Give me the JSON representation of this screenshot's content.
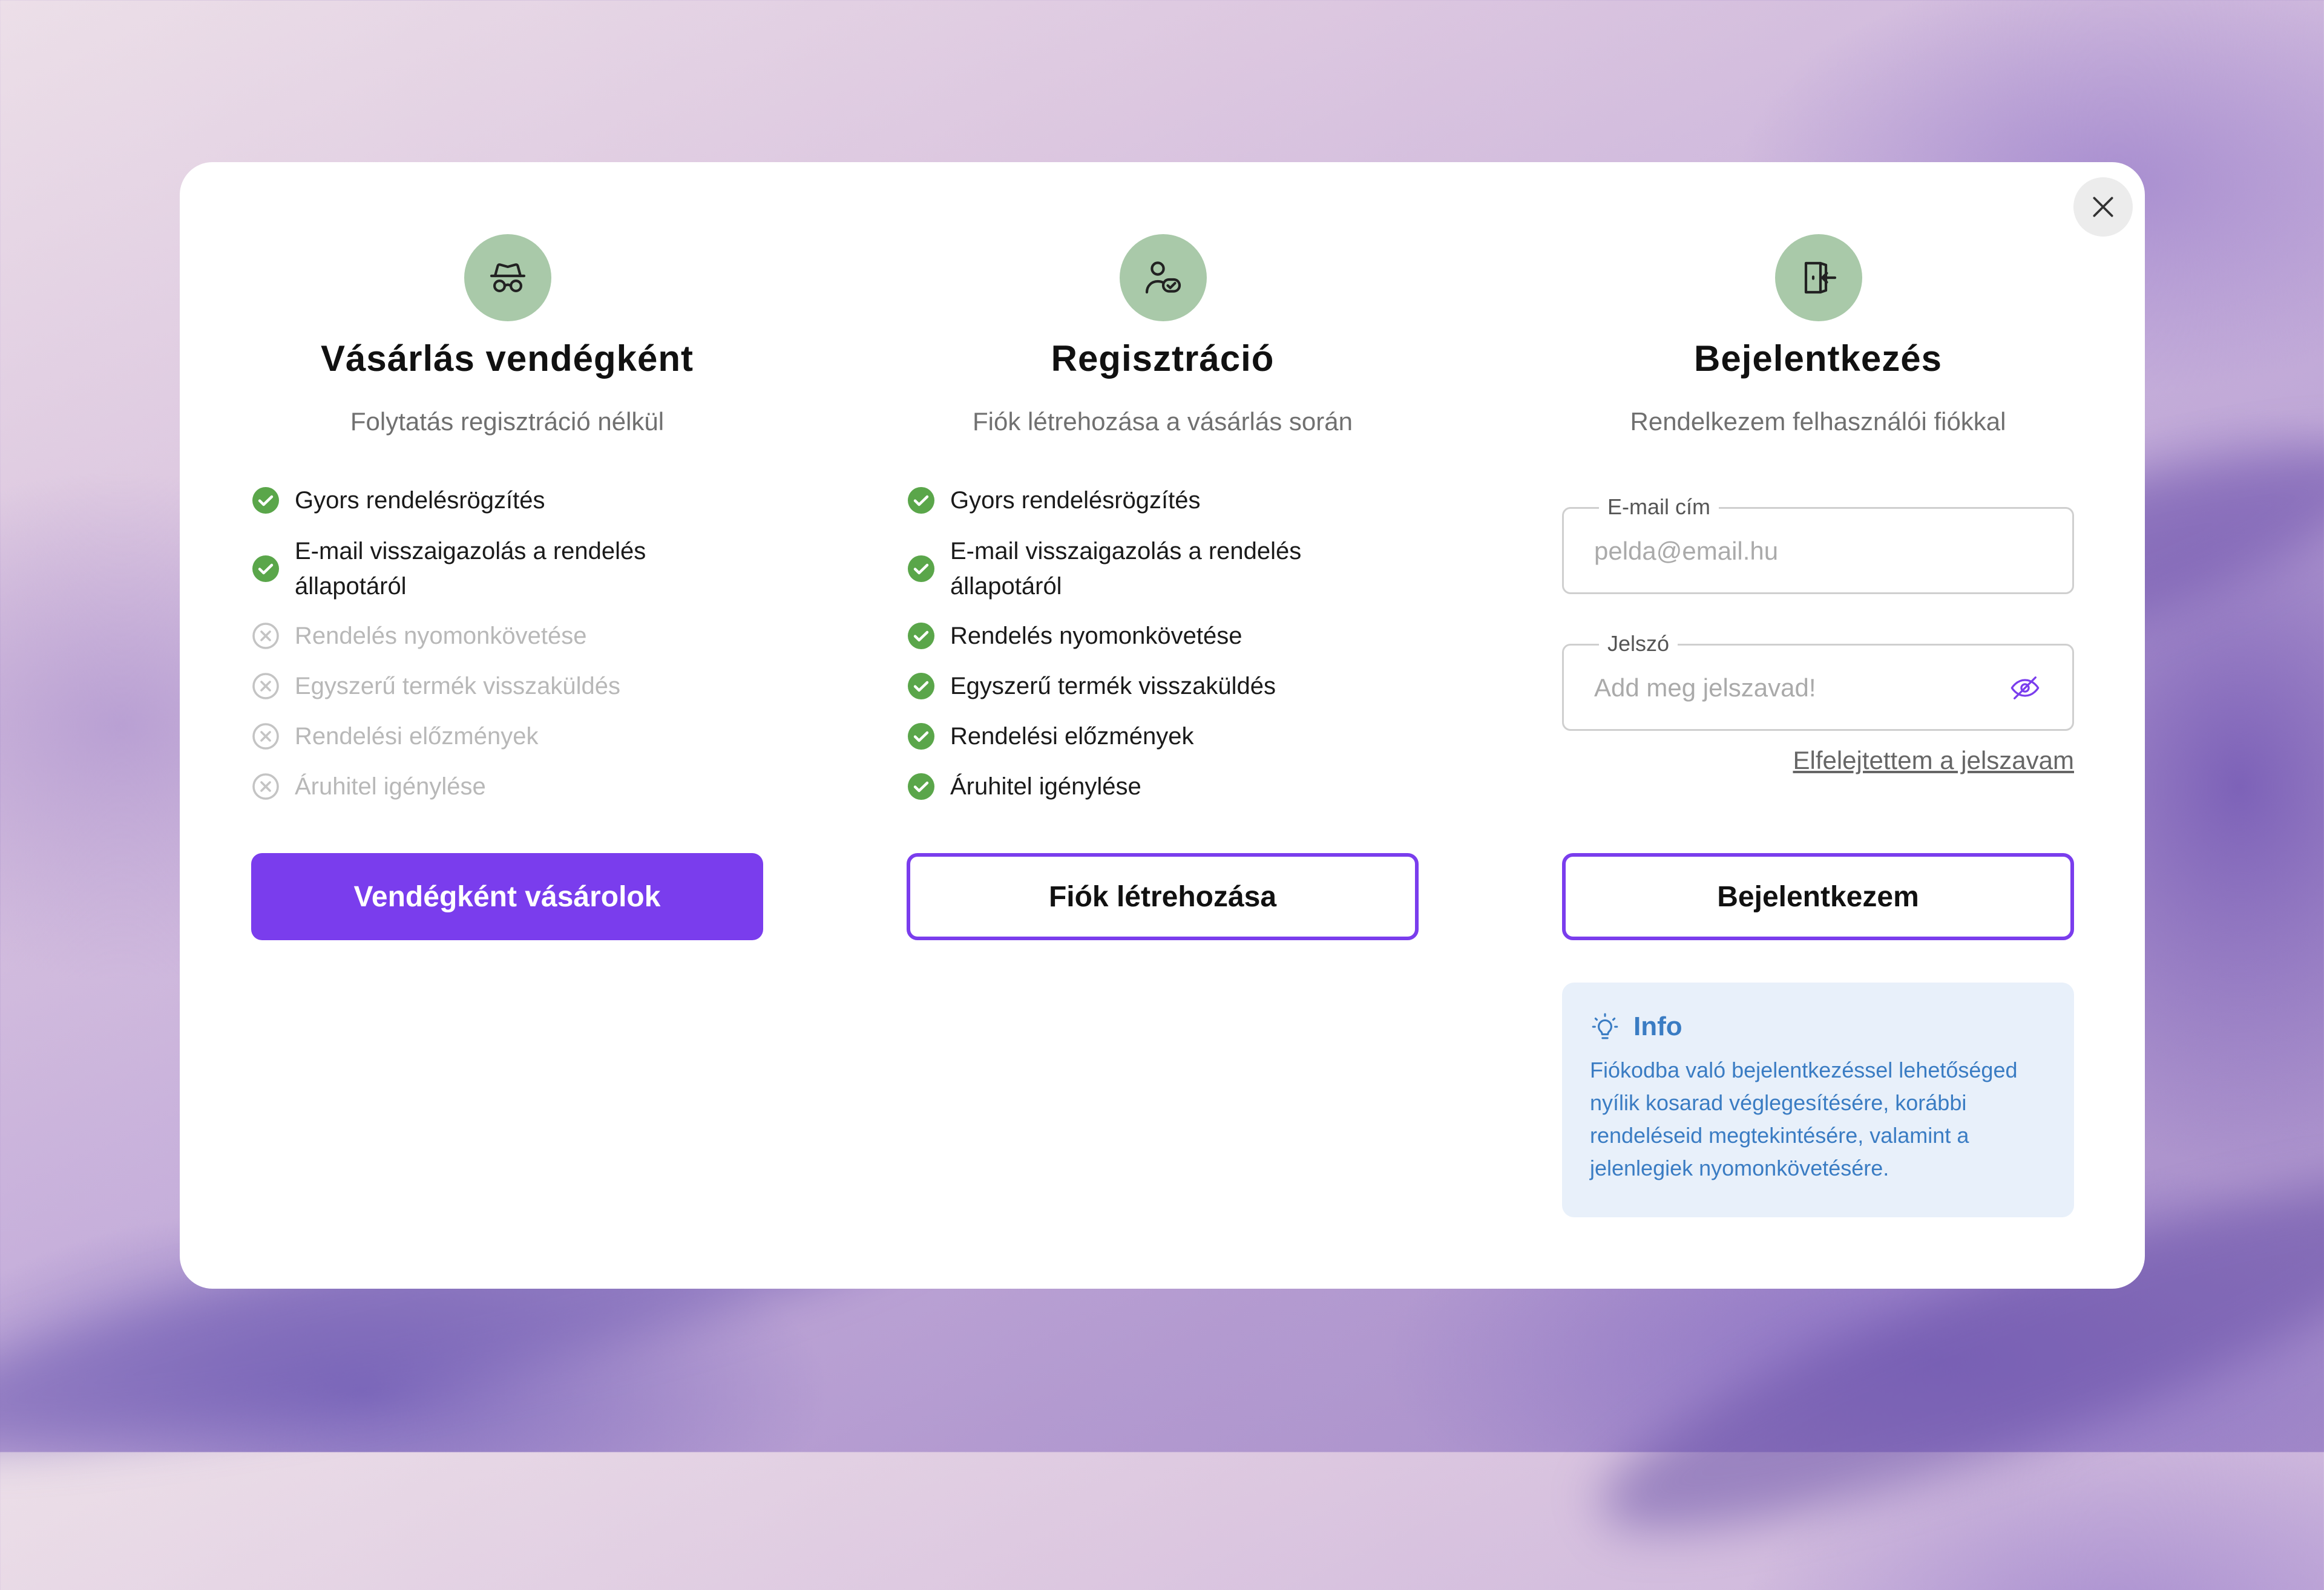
{
  "close": {
    "icon": "close-icon"
  },
  "guest": {
    "icon": "incognito-icon",
    "title": "Vásárlás vendégként",
    "subtitle": "Folytatás regisztráció nélkül",
    "features": [
      {
        "label": "Gyors rendelésrögzítés",
        "available": true
      },
      {
        "label": "E-mail visszaigazolás a rendelés állapotáról",
        "available": true
      },
      {
        "label": "Rendelés nyomonkövetése",
        "available": false
      },
      {
        "label": "Egyszerű termék visszaküldés",
        "available": false
      },
      {
        "label": "Rendelési előzmények",
        "available": false
      },
      {
        "label": "Áruhitel igénylése",
        "available": false
      }
    ],
    "button": "Vendégként vásárolok"
  },
  "register": {
    "icon": "user-check-icon",
    "title": "Regisztráció",
    "subtitle": "Fiók létrehozása a vásárlás során",
    "features": [
      {
        "label": "Gyors rendelésrögzítés",
        "available": true
      },
      {
        "label": "E-mail visszaigazolás a rendelés állapotáról",
        "available": true
      },
      {
        "label": "Rendelés nyomonkövetése",
        "available": true
      },
      {
        "label": "Egyszerű termék visszaküldés",
        "available": true
      },
      {
        "label": "Rendelési előzmények",
        "available": true
      },
      {
        "label": "Áruhitel igénylése",
        "available": true
      }
    ],
    "button": "Fiók létrehozása"
  },
  "login": {
    "icon": "login-door-icon",
    "title": "Bejelentkezés",
    "subtitle": "Rendelkezem felhasználói fiókkal",
    "email": {
      "label": "E-mail cím",
      "placeholder": "pelda@email.hu",
      "value": ""
    },
    "password": {
      "label": "Jelszó",
      "placeholder": "Add meg jelszavad!",
      "value": "",
      "toggle_icon": "eye-off-icon"
    },
    "forgot": "Elfelejtettem a jelszavam",
    "button": "Bejelentkezem",
    "info": {
      "icon": "lightbulb-icon",
      "title": "Info",
      "text": "Fiókodba való bejelentkezéssel lehetőséged nyílik kosarad véglegesítésére, korábbi rendeléseid megtekintésére, valamint a jelenlegiek nyomonkövetésére."
    }
  },
  "colors": {
    "accent": "#7a3ded",
    "check": "#5aa64a",
    "icon_bg": "#a9c9a9",
    "info_bg": "#e8f0fa",
    "info_text": "#3a7cc3"
  }
}
